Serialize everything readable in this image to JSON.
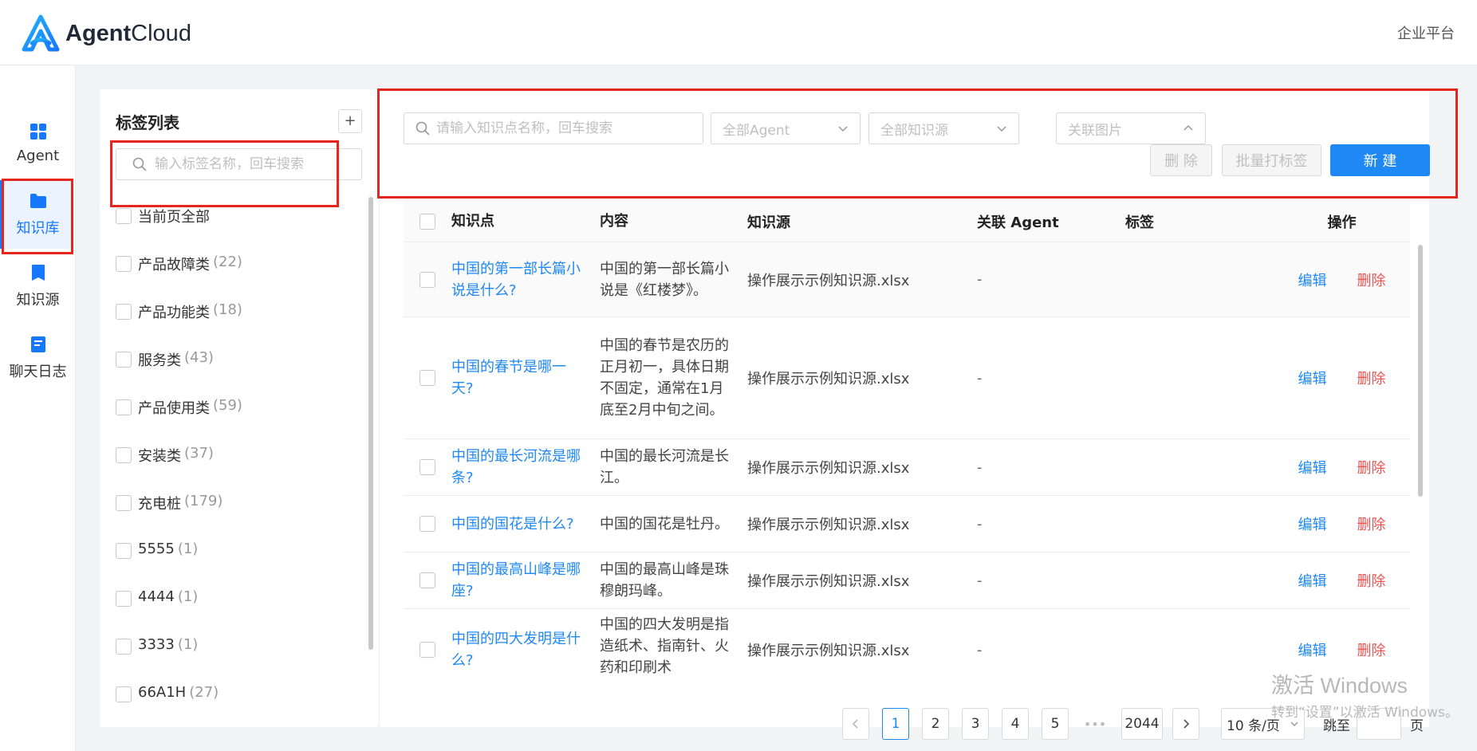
{
  "header": {
    "brand_bold": "Agent",
    "brand_light": "Cloud",
    "platform_link": "企业平台"
  },
  "nav": {
    "items": [
      {
        "label": "Agent",
        "icon": "grid-icon"
      },
      {
        "label": "知识库",
        "icon": "folder-icon",
        "active": true
      },
      {
        "label": "知识源",
        "icon": "book-icon"
      },
      {
        "label": "聊天日志",
        "icon": "log-icon"
      }
    ]
  },
  "tags": {
    "title": "标签列表",
    "add_label": "+",
    "search_placeholder": "输入标签名称，回车搜索",
    "items": [
      {
        "label": "当前页全部",
        "count": ""
      },
      {
        "label": "产品故障类",
        "count": "(22)"
      },
      {
        "label": "产品功能类",
        "count": "(18)"
      },
      {
        "label": "服务类",
        "count": "(43)"
      },
      {
        "label": "产品使用类",
        "count": "(59)"
      },
      {
        "label": "安装类",
        "count": "(37)"
      },
      {
        "label": "充电桩",
        "count": "(179)"
      },
      {
        "label": "5555",
        "count": "(1)"
      },
      {
        "label": "4444",
        "count": "(1)"
      },
      {
        "label": "3333",
        "count": "(1)"
      },
      {
        "label": "66A1H",
        "count": "(27)"
      }
    ]
  },
  "filters": {
    "search_placeholder": "请输入知识点名称，回车搜索",
    "agent_select": "全部Agent",
    "source_select": "全部知识源",
    "image_select": "关联图片"
  },
  "actions": {
    "delete": "删 除",
    "batch_tag": "批量打标签",
    "create": "新 建"
  },
  "table": {
    "headers": {
      "name": "知识点",
      "content": "内容",
      "source": "知识源",
      "agent": "关联 Agent",
      "tags": "标签",
      "ops": "操作"
    },
    "edit_label": "编辑",
    "delete_label": "删除",
    "rows": [
      {
        "name": "中国的第一部长篇小说是什么?",
        "content": "中国的第一部长篇小说是《红楼梦》。",
        "source": "操作展示示例知识源.xlsx",
        "agent": "-",
        "tags": ""
      },
      {
        "name": "中国的春节是哪一天?",
        "content": "中国的春节是农历的正月初一，具体日期不固定，通常在1月底至2月中旬之间。",
        "source": "操作展示示例知识源.xlsx",
        "agent": "-",
        "tags": ""
      },
      {
        "name": "中国的最长河流是哪条?",
        "content": "中国的最长河流是长江。",
        "source": "操作展示示例知识源.xlsx",
        "agent": "-",
        "tags": ""
      },
      {
        "name": "中国的国花是什么?",
        "content": "中国的国花是牡丹。",
        "source": "操作展示示例知识源.xlsx",
        "agent": "-",
        "tags": ""
      },
      {
        "name": "中国的最高山峰是哪座?",
        "content": "中国的最高山峰是珠穆朗玛峰。",
        "source": "操作展示示例知识源.xlsx",
        "agent": "-",
        "tags": ""
      },
      {
        "name": "中国的四大发明是什么?",
        "content": "中国的四大发明是指造纸术、指南针、火药和印刷术",
        "source": "操作展示示例知识源.xlsx",
        "agent": "-",
        "tags": ""
      }
    ]
  },
  "pagination": {
    "pages": [
      "1",
      "2",
      "3",
      "4",
      "5"
    ],
    "current": "1",
    "ellipsis": "•••",
    "last": "2044",
    "page_size": "10 条/页",
    "jump_label": "跳至",
    "page_unit": "页"
  },
  "watermark": {
    "line1": "激活 Windows",
    "line2": "转到“设置”以激活 Windows。"
  },
  "colors": {
    "primary": "#1e88f5",
    "danger": "#f0504f",
    "annotation": "#e5261c"
  }
}
